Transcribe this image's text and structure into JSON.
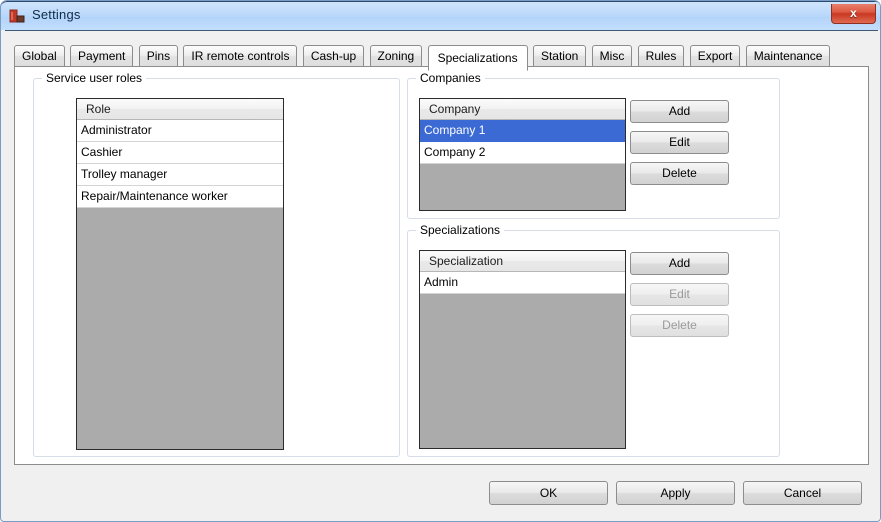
{
  "window": {
    "title": "Settings",
    "icon": "app-icon",
    "close_label": "x",
    "titlebar_color": "#bcd9fb",
    "close_color": "#c93822"
  },
  "tabs": [
    {
      "label": "Global",
      "active": false
    },
    {
      "label": "Payment",
      "active": false
    },
    {
      "label": "Pins",
      "active": false
    },
    {
      "label": "IR remote controls",
      "active": false
    },
    {
      "label": "Cash-up",
      "active": false
    },
    {
      "label": "Zoning",
      "active": false
    },
    {
      "label": "Specializations",
      "active": true
    },
    {
      "label": "Station",
      "active": false
    },
    {
      "label": "Misc",
      "active": false
    },
    {
      "label": "Rules",
      "active": false
    },
    {
      "label": "Export",
      "active": false
    },
    {
      "label": "Maintenance",
      "active": false
    }
  ],
  "service_user_roles": {
    "legend": "Service user roles",
    "column_header": "Role",
    "rows": [
      "Administrator",
      "Cashier",
      "Trolley manager",
      "Repair/Maintenance worker"
    ]
  },
  "companies": {
    "legend": "Companies",
    "column_header": "Company",
    "rows": [
      {
        "label": "Company 1",
        "selected": true
      },
      {
        "label": "Company 2",
        "selected": false
      }
    ],
    "selection_color": "#3c6ad4",
    "buttons": [
      {
        "label": "Add",
        "enabled": true
      },
      {
        "label": "Edit",
        "enabled": true
      },
      {
        "label": "Delete",
        "enabled": true
      }
    ]
  },
  "specializations": {
    "legend": "Specializations",
    "column_header": "Specialization",
    "rows": [
      {
        "label": "Admin",
        "selected": false
      }
    ],
    "buttons": [
      {
        "label": "Add",
        "enabled": true
      },
      {
        "label": "Edit",
        "enabled": false
      },
      {
        "label": "Delete",
        "enabled": false
      }
    ]
  },
  "dialog_buttons": [
    {
      "label": "OK"
    },
    {
      "label": "Apply"
    },
    {
      "label": "Cancel"
    }
  ]
}
